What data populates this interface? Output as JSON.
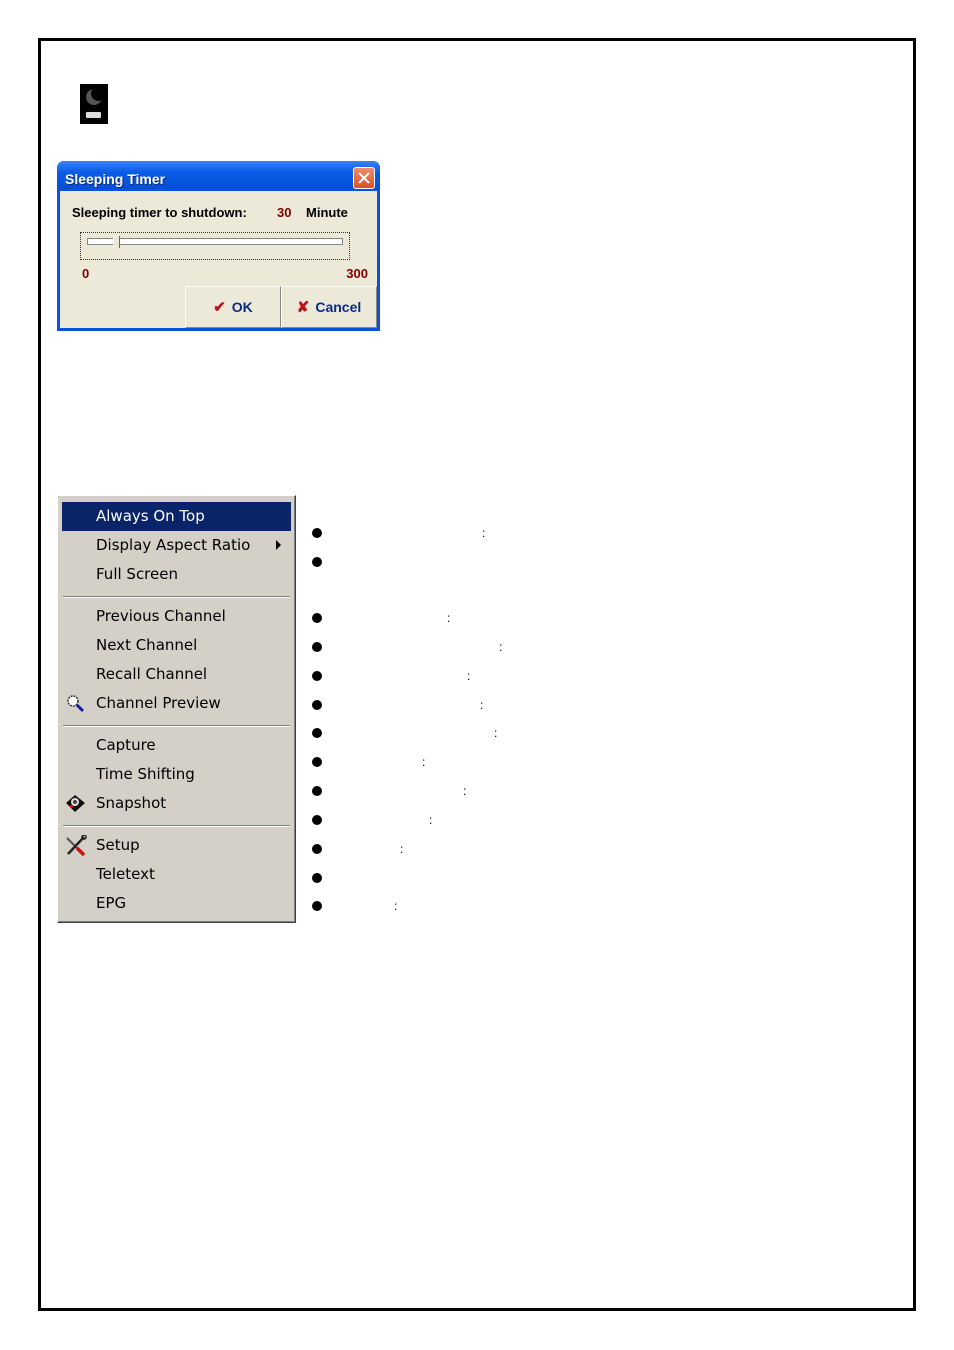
{
  "dialog": {
    "title": "Sleeping Timer",
    "label": "Sleeping timer to shutdown:",
    "value": "30",
    "unit": "Minute",
    "slider": {
      "min_label": "0",
      "max_label": "300",
      "min": 0,
      "max": 300,
      "value": 30
    },
    "ok_label": "OK",
    "cancel_label": "Cancel",
    "ok_icon": "✔",
    "cancel_icon": "✘"
  },
  "menu": {
    "items": [
      {
        "label": "Always On Top",
        "highlighted": true
      },
      {
        "label": "Display Aspect Ratio",
        "submenu": true
      },
      {
        "label": "Full Screen"
      },
      {
        "label": "Previous Channel"
      },
      {
        "label": "Next Channel"
      },
      {
        "label": "Recall Channel"
      },
      {
        "label": "Channel Preview",
        "icon": "magnifier-icon"
      },
      {
        "label": "Capture"
      },
      {
        "label": "Time Shifting"
      },
      {
        "label": "Snapshot",
        "icon": "camera-icon"
      },
      {
        "label": "Setup",
        "icon": "tools-icon"
      },
      {
        "label": "Teletext"
      },
      {
        "label": "EPG"
      }
    ]
  },
  "bullets": {
    "colon": ":",
    "count": 13
  }
}
